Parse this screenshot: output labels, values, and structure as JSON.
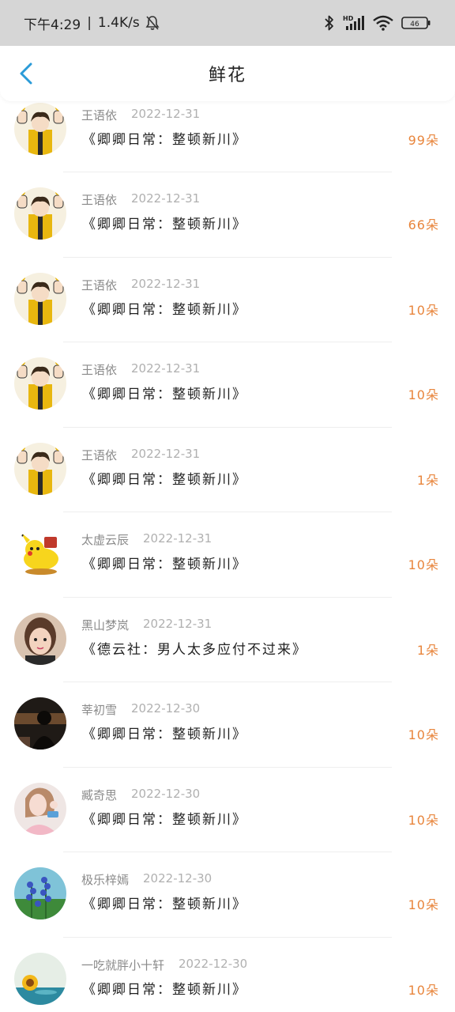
{
  "status_bar": {
    "time": "下午4:29",
    "speed": "1.4K/s",
    "battery": "46",
    "icons": [
      "bell-off-icon",
      "bluetooth-icon",
      "hd-signal-icon",
      "wifi-icon",
      "battery-icon"
    ]
  },
  "header": {
    "title": "鲜花",
    "back_icon": "chevron-left-icon"
  },
  "colors": {
    "accent": "#2b9bd8",
    "count": "#e8853c",
    "status_bar_bg": "#d6d6d6"
  },
  "rows": [
    {
      "user": "王语依",
      "date": "2022-12-31",
      "title": "《卿卿日常：整顿新川》",
      "count": "99朵",
      "avatar": "yellow-cartoon"
    },
    {
      "user": "王语依",
      "date": "2022-12-31",
      "title": "《卿卿日常：整顿新川》",
      "count": "66朵",
      "avatar": "yellow-cartoon"
    },
    {
      "user": "王语依",
      "date": "2022-12-31",
      "title": "《卿卿日常：整顿新川》",
      "count": "10朵",
      "avatar": "yellow-cartoon"
    },
    {
      "user": "王语依",
      "date": "2022-12-31",
      "title": "《卿卿日常：整顿新川》",
      "count": "10朵",
      "avatar": "yellow-cartoon"
    },
    {
      "user": "王语依",
      "date": "2022-12-31",
      "title": "《卿卿日常：整顿新川》",
      "count": "1朵",
      "avatar": "yellow-cartoon"
    },
    {
      "user": "太虚云辰",
      "date": "2022-12-31",
      "title": "《卿卿日常：整顿新川》",
      "count": "10朵",
      "avatar": "pikachu"
    },
    {
      "user": "黑山梦岚",
      "date": "2022-12-31",
      "title": "《德云社：男人太多应付不过来》",
      "count": "1朵",
      "avatar": "child-photo"
    },
    {
      "user": "莘初雪",
      "date": "2022-12-30",
      "title": "《卿卿日常：整顿新川》",
      "count": "10朵",
      "avatar": "dark-photo"
    },
    {
      "user": "臧奇思",
      "date": "2022-12-30",
      "title": "《卿卿日常：整顿新川》",
      "count": "10朵",
      "avatar": "girl-photo"
    },
    {
      "user": "极乐梓嫣",
      "date": "2022-12-30",
      "title": "《卿卿日常：整顿新川》",
      "count": "10朵",
      "avatar": "blue-flowers"
    },
    {
      "user": "一吃就胖小十轩",
      "date": "2022-12-30",
      "title": "《卿卿日常：整顿新川》",
      "count": "10朵",
      "avatar": "sunflower"
    }
  ]
}
